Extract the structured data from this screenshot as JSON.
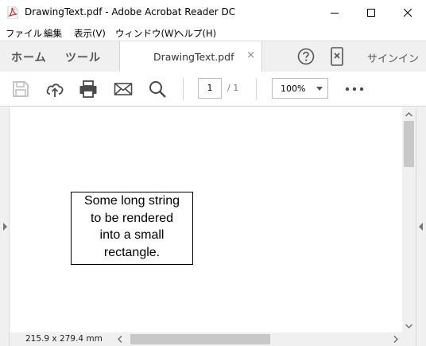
{
  "window": {
    "title": "DrawingText.pdf - Adobe Acrobat Reader DC",
    "minimize_icon": "minimize-icon",
    "maximize_icon": "maximize-icon",
    "close_icon": "close-icon"
  },
  "menu": {
    "items": [
      "ファイル",
      "編集",
      "表示(V)",
      "ウィンドウ(W)",
      "ヘルプ(H)"
    ]
  },
  "tabs": {
    "home": "ホーム",
    "tools": "ツール",
    "document": "DrawingText.pdf",
    "close_glyph": "×",
    "signin": "サインイン"
  },
  "toolbar": {
    "icons": [
      "save-icon",
      "cloud-upload-icon",
      "print-icon",
      "mail-icon",
      "search-icon"
    ],
    "current_page": "1",
    "page_total": "/ 1",
    "zoom": "100%"
  },
  "document": {
    "text_lines": [
      "Some long string",
      "to be rendered",
      "into a small",
      "rectangle."
    ]
  },
  "status": {
    "page_size": "215.9 x 279.4 mm"
  },
  "colors": {
    "acrobat_red": "#d32f2f",
    "icon_gray": "#4a4a4a",
    "disabled_gray": "#b8b8b8",
    "chrome_bg": "#f0f0f0"
  }
}
